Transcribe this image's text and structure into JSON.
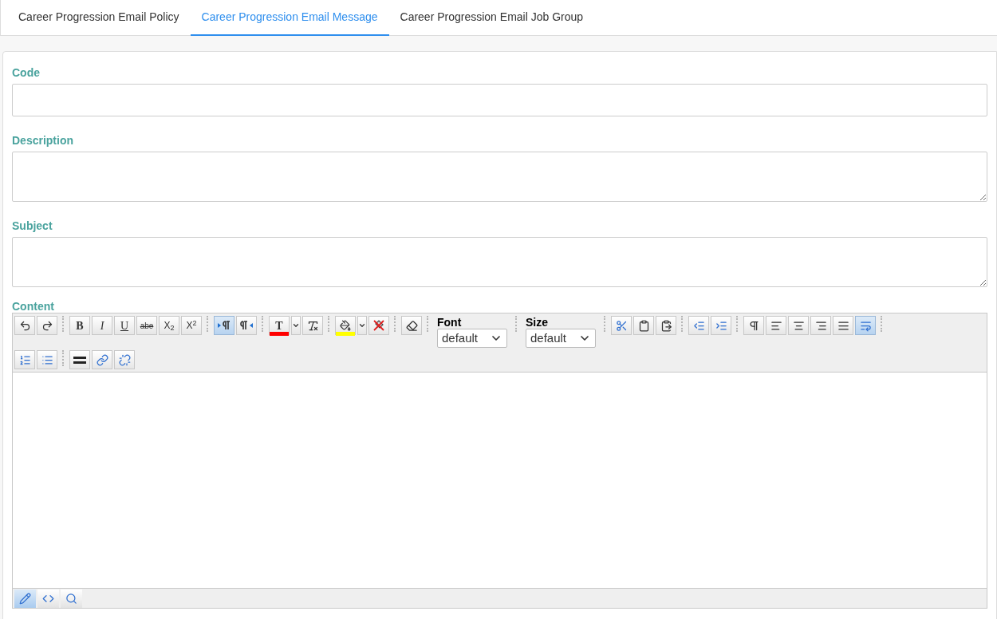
{
  "tabs": [
    {
      "label": "Career Progression Email Policy",
      "selected": false
    },
    {
      "label": "Career Progression Email Message",
      "selected": true
    },
    {
      "label": "Career Progression Email Job Group",
      "selected": false
    }
  ],
  "fields": [
    {
      "kind": "input",
      "label": "Code"
    },
    {
      "kind": "textarea",
      "label": "Description"
    },
    {
      "kind": "textarea",
      "label": "Subject"
    }
  ],
  "content": {
    "label": "Content",
    "toolbar_rows": [
      [
        {
          "kind": "undo",
          "selected": false
        },
        {
          "kind": "redo",
          "selected": false
        },
        {
          "kind": "separator"
        },
        {
          "kind": "bold",
          "label": "B",
          "selected": false
        },
        {
          "kind": "italic",
          "label": "I",
          "selected": false
        },
        {
          "kind": "underline",
          "label": "U",
          "selected": false
        },
        {
          "kind": "strike",
          "label": "abe",
          "selected": false
        },
        {
          "kind": "script",
          "label": "X$_{2}$",
          "selected": false
        },
        {
          "kind": "script",
          "label": "X$^{2}$",
          "selected": false
        },
        {
          "kind": "separator"
        },
        {
          "kind": "ltr",
          "selected": true
        },
        {
          "kind": "rtl",
          "selected": false
        },
        {
          "kind": "separator"
        },
        {
          "kind": "forecolor",
          "label": "T",
          "color": "#ff0000",
          "selected": false
        },
        {
          "kind": "dropdown"
        },
        {
          "kind": "clearcolor",
          "selected": false
        },
        {
          "kind": "separator"
        },
        {
          "kind": "backcolor",
          "color": "#ffff00",
          "selected": false
        },
        {
          "kind": "dropdown"
        },
        {
          "kind": "clearback",
          "selected": false
        },
        {
          "kind": "separator"
        },
        {
          "kind": "eraser",
          "selected": false
        },
        {
          "kind": "separator"
        },
        {
          "kind": "select",
          "label": "Font",
          "value": "default"
        },
        {
          "kind": "separator"
        },
        {
          "kind": "select",
          "label": "Size",
          "value": "default"
        },
        {
          "kind": "separator"
        },
        {
          "kind": "cut",
          "selected": false
        },
        {
          "kind": "copy",
          "selected": false
        },
        {
          "kind": "pasteword",
          "selected": false
        },
        {
          "kind": "separator"
        },
        {
          "kind": "outdent",
          "selected": false
        },
        {
          "kind": "indent",
          "selected": false
        },
        {
          "kind": "separator"
        },
        {
          "kind": "paragraph",
          "selected": false
        },
        {
          "kind": "alignleft",
          "selected": false
        },
        {
          "kind": "aligncenter",
          "selected": false
        },
        {
          "kind": "alignright",
          "selected": false
        },
        {
          "kind": "justify",
          "selected": false
        },
        {
          "kind": "wrap",
          "selected": true
        },
        {
          "kind": "separator"
        }
      ],
      [
        {
          "kind": "orderedlist",
          "selected": false
        },
        {
          "kind": "bulletlist",
          "selected": false
        },
        {
          "kind": "separator"
        },
        {
          "kind": "rule",
          "selected": false
        },
        {
          "kind": "link",
          "selected": false
        },
        {
          "kind": "unlink",
          "selected": false
        }
      ]
    ],
    "modes": [
      {
        "kind": "design",
        "selected": true
      },
      {
        "kind": "html",
        "selected": false
      },
      {
        "kind": "preview",
        "selected": false
      }
    ]
  }
}
